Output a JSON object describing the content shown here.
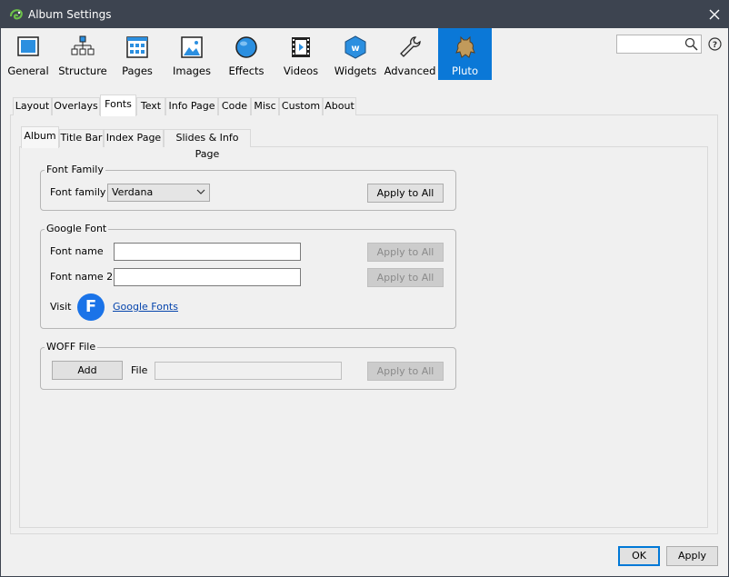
{
  "window": {
    "title": "Album Settings",
    "app_icon": "chameleon-icon",
    "close_icon": "close-icon"
  },
  "toolbar": {
    "items": [
      {
        "label": "General",
        "icon": "monitor-icon"
      },
      {
        "label": "Structure",
        "icon": "sitemap-icon"
      },
      {
        "label": "Pages",
        "icon": "pages-grid-icon"
      },
      {
        "label": "Images",
        "icon": "image-icon"
      },
      {
        "label": "Effects",
        "icon": "sphere-icon"
      },
      {
        "label": "Videos",
        "icon": "film-icon"
      },
      {
        "label": "Widgets",
        "icon": "widget-hexagon-icon"
      },
      {
        "label": "Advanced",
        "icon": "wrench-icon"
      },
      {
        "label": "Pluto",
        "icon": "hide-icon"
      }
    ],
    "active": "Pluto",
    "search_placeholder": "",
    "accent": "#0b78d7"
  },
  "tabs": [
    "Layout",
    "Overlays",
    "Fonts",
    "Text",
    "Info Page",
    "Code",
    "Misc",
    "Custom",
    "About"
  ],
  "active_tab": "Fonts",
  "subtabs": [
    "Album",
    "Title Bar",
    "Index Page",
    "Slides & Info Page"
  ],
  "active_subtab": "Album",
  "font_family": {
    "legend": "Font Family",
    "label": "Font family",
    "value": "Verdana",
    "apply_label": "Apply to All"
  },
  "google_font": {
    "legend": "Google Font",
    "name_label": "Font name",
    "name_value": "",
    "name2_label": "Font name 2",
    "name2_value": "",
    "apply1_label": "Apply to All",
    "apply2_label": "Apply to All",
    "visit_label": "Visit",
    "badge_letter": "F",
    "link_text": "Google Fonts"
  },
  "woff": {
    "legend": "WOFF File",
    "add_label": "Add",
    "file_label": "File",
    "file_value": "",
    "apply_label": "Apply to All"
  },
  "footer": {
    "ok_label": "OK",
    "apply_label": "Apply"
  }
}
